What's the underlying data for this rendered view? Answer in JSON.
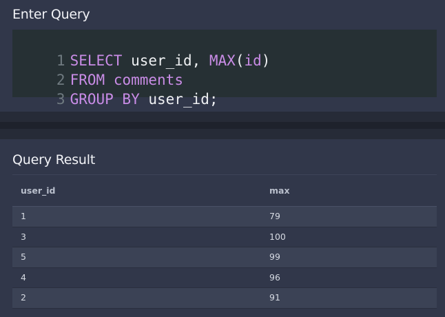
{
  "query_section": {
    "title": "Enter Query",
    "code_lines": [
      {
        "number": "1",
        "tokens": [
          {
            "text": "SELECT",
            "kind": "keyword"
          },
          {
            "text": " user_id, ",
            "kind": "plain"
          },
          {
            "text": "MAX",
            "kind": "keyword"
          },
          {
            "text": "(",
            "kind": "plain"
          },
          {
            "text": "id",
            "kind": "keyword"
          },
          {
            "text": ")",
            "kind": "plain"
          }
        ]
      },
      {
        "number": "2",
        "tokens": [
          {
            "text": "FROM",
            "kind": "keyword"
          },
          {
            "text": " ",
            "kind": "plain"
          },
          {
            "text": "comments",
            "kind": "keyword"
          }
        ]
      },
      {
        "number": "3",
        "tokens": [
          {
            "text": "GROUP BY",
            "kind": "keyword"
          },
          {
            "text": " user_id;",
            "kind": "plain"
          }
        ]
      }
    ]
  },
  "result_section": {
    "title": "Query Result",
    "columns": [
      "user_id",
      "max"
    ],
    "rows": [
      [
        "1",
        "79"
      ],
      [
        "3",
        "100"
      ],
      [
        "5",
        "99"
      ],
      [
        "4",
        "96"
      ],
      [
        "2",
        "91"
      ]
    ]
  },
  "colors": {
    "keyword": "#c98ce6",
    "plain_code": "#eef0f2",
    "editor_bg": "#263034",
    "panel_bg": "#31374a",
    "row_alt_bg": "#3b4255"
  }
}
